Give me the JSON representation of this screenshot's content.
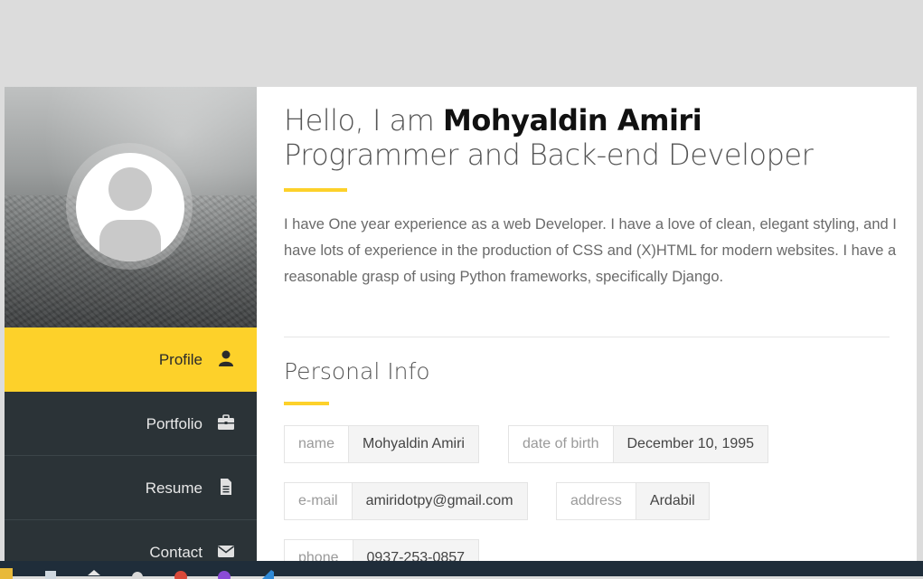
{
  "profile": {
    "greeting": "Hello, I am ",
    "name": "Mohyaldin Amiri",
    "role": "Programmer and Back-end Developer",
    "bio": "I have One year experience as a web Developer. I have a love of clean, elegant styling, and I have lots of experience in the production of CSS and (X)HTML for modern websites. I have a reasonable grasp of using Python frameworks, specifically Django."
  },
  "nav": {
    "items": [
      {
        "label": "Profile",
        "icon": "user-icon"
      },
      {
        "label": "Portfolio",
        "icon": "briefcase-icon"
      },
      {
        "label": "Resume",
        "icon": "document-icon"
      },
      {
        "label": "Contact",
        "icon": "envelope-icon"
      }
    ]
  },
  "personal_info": {
    "title": "Personal Info",
    "fields": [
      {
        "key": "name",
        "value": "Mohyaldin Amiri"
      },
      {
        "key": "date of birth",
        "value": "December 10, 1995"
      },
      {
        "key": "e-mail",
        "value": "amiridotpy@gmail.com"
      },
      {
        "key": "address",
        "value": "Ardabil"
      },
      {
        "key": "phone",
        "value": "0937-253-0857"
      }
    ]
  },
  "colors": {
    "accent": "#fdd12a",
    "sidebar": "#2b3337",
    "background": "#dcdcdc"
  }
}
